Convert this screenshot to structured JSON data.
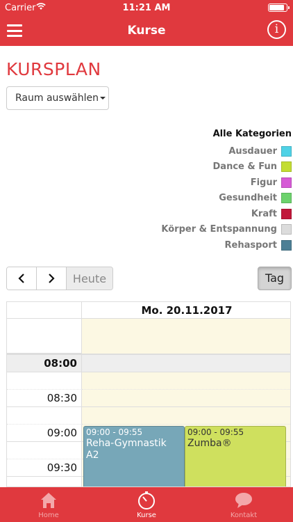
{
  "status": {
    "carrier": "Carrier",
    "time": "11:21 AM",
    "battery_level": 0.9
  },
  "nav": {
    "title": "Kurse"
  },
  "page": {
    "title": "KURSPLAN"
  },
  "room_select": {
    "label": "Raum auswählen"
  },
  "legend": {
    "heading": "Alle Kategorien",
    "items": [
      {
        "label": "Ausdauer",
        "color": "#4fd2e6"
      },
      {
        "label": "Dance & Fun",
        "color": "#c3dd32"
      },
      {
        "label": "Figur",
        "color": "#d65bd6"
      },
      {
        "label": "Gesundheit",
        "color": "#6cd26c"
      },
      {
        "label": "Kraft",
        "color": "#c1173a"
      },
      {
        "label": "Körper & Entspannung",
        "color": "#dcdcdc"
      },
      {
        "label": "Rehasport",
        "color": "#4d7f95"
      }
    ]
  },
  "toolbar": {
    "prev_icon": "chevron-left-icon",
    "next_icon": "chevron-right-icon",
    "today_label": "Heute",
    "view_label": "Tag"
  },
  "calendar": {
    "day_header": "Mo. 20.11.2017",
    "time_labels": [
      "08:00",
      "",
      "08:30",
      "",
      "09:00",
      "",
      "09:30",
      ""
    ],
    "events": [
      {
        "time": "09:00 - 09:55",
        "title": "Reha-Gymnastik A2",
        "color": "#77a7b8"
      },
      {
        "time": "09:00 - 09:55",
        "title": "Zumba®",
        "color": "#cfe05e"
      }
    ]
  },
  "tabbar": {
    "items": [
      {
        "label": "Home",
        "icon": "home-icon",
        "active": false
      },
      {
        "label": "Kurse",
        "icon": "stopwatch-icon",
        "active": true
      },
      {
        "label": "Kontakt",
        "icon": "chat-bubble-icon",
        "active": false
      }
    ]
  }
}
